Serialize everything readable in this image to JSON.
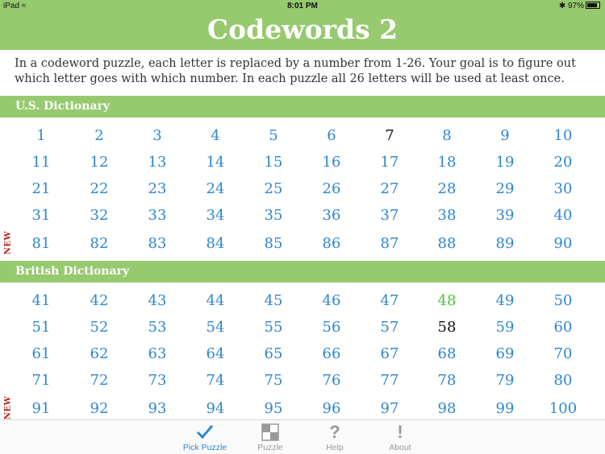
{
  "status": {
    "device": "iPad",
    "time": "8:01 PM",
    "battery": "97%"
  },
  "header": {
    "title": "Codewords 2"
  },
  "intro": "In a codeword puzzle, each letter is replaced by a number from 1-26. Your goal is to figure out which letter goes with which number. In each puzzle all 26 letters will be used at least once.",
  "sections": [
    {
      "title": "U.S. Dictionary",
      "rows": [
        [
          "1",
          "2",
          "3",
          "4",
          "5",
          "6",
          "7",
          "8",
          "9",
          "10"
        ],
        [
          "11",
          "12",
          "13",
          "14",
          "15",
          "16",
          "17",
          "18",
          "19",
          "20"
        ],
        [
          "21",
          "22",
          "23",
          "24",
          "25",
          "26",
          "27",
          "28",
          "29",
          "30"
        ],
        [
          "31",
          "32",
          "33",
          "34",
          "35",
          "36",
          "37",
          "38",
          "39",
          "40"
        ],
        [
          "81",
          "82",
          "83",
          "84",
          "85",
          "86",
          "87",
          "88",
          "89",
          "90"
        ]
      ]
    },
    {
      "title": "British Dictionary",
      "rows": [
        [
          "41",
          "42",
          "43",
          "44",
          "45",
          "46",
          "47",
          "48",
          "49",
          "50"
        ],
        [
          "51",
          "52",
          "53",
          "54",
          "55",
          "56",
          "57",
          "58",
          "59",
          "60"
        ],
        [
          "61",
          "62",
          "63",
          "64",
          "65",
          "66",
          "67",
          "68",
          "69",
          "70"
        ],
        [
          "71",
          "72",
          "73",
          "74",
          "75",
          "76",
          "77",
          "78",
          "79",
          "80"
        ],
        [
          "91",
          "92",
          "93",
          "94",
          "95",
          "96",
          "97",
          "98",
          "99",
          "100"
        ]
      ]
    }
  ],
  "new_label": "NEW",
  "colors": {
    "accent": "#97c96f",
    "link": "#2f86d0",
    "completed": "#111111",
    "inprogress": "#4cc23a",
    "new": "#b3231a"
  },
  "puzzle_states": {
    "7": "completed",
    "58": "completed",
    "48": "in-progress"
  },
  "tabs": [
    {
      "label": "Pick Puzzle",
      "icon": "checkmark-icon",
      "active": true
    },
    {
      "label": "Puzzle",
      "icon": "grid-icon",
      "active": false
    },
    {
      "label": "Help",
      "icon": "question-icon",
      "active": false
    },
    {
      "label": "About",
      "icon": "exclamation-icon",
      "active": false
    }
  ]
}
